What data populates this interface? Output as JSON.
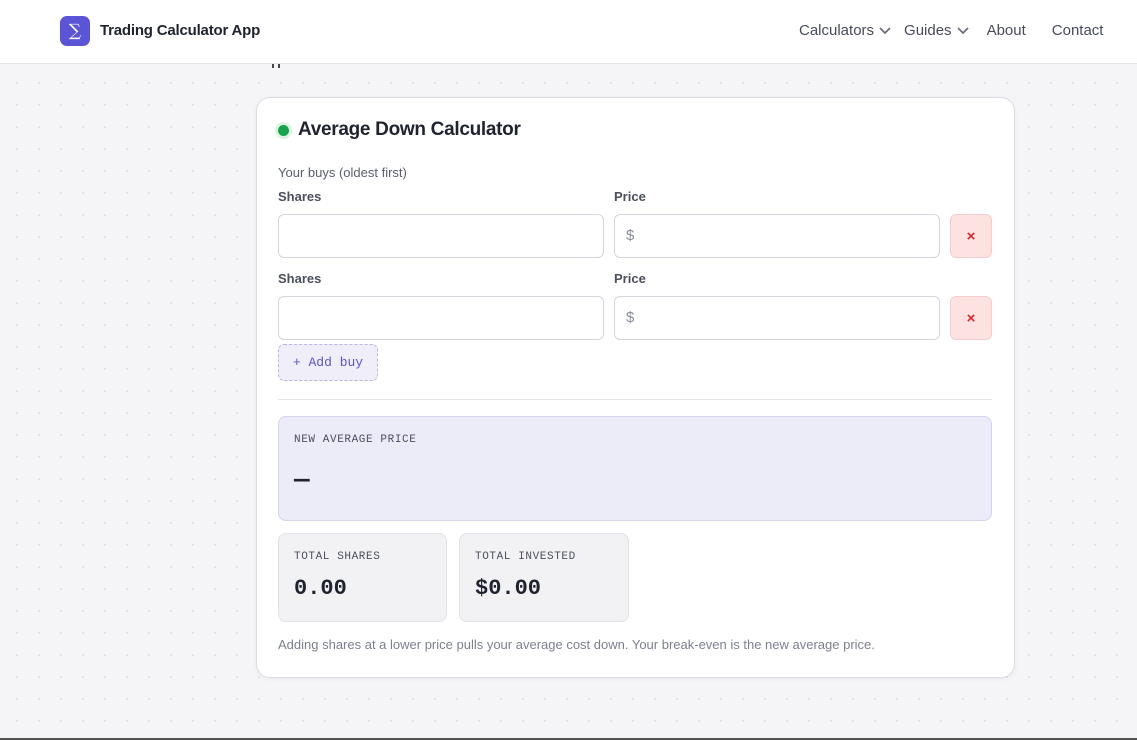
{
  "header": {
    "logo_glyph": "∑",
    "brand": "Trading Calculator App",
    "nav": [
      {
        "label": "Calculators",
        "icon": "chevron-down-icon"
      },
      {
        "label": "Guides",
        "icon": "chevron-down-icon"
      },
      {
        "label": "About"
      },
      {
        "label": "Contact"
      }
    ]
  },
  "calculator": {
    "title": "Average Down Calculator",
    "status_color": "#16a34a",
    "hint": "Your buys (oldest first)",
    "rows": [
      {
        "shares_label": "Shares",
        "price_label": "Price",
        "shares_value": "",
        "price_value": "",
        "currency": "$",
        "remove_label": "×"
      },
      {
        "shares_label": "Shares",
        "price_label": "Price",
        "shares_value": "",
        "price_value": "",
        "currency": "$",
        "remove_label": "×"
      }
    ],
    "add_label": "+ Add buy",
    "result": {
      "label": "NEW AVERAGE PRICE",
      "value": "—"
    },
    "stats": [
      {
        "label": "TOTAL SHARES",
        "value": "0.00"
      },
      {
        "label": "TOTAL INVESTED",
        "value": "$0.00"
      }
    ],
    "note": "Adding shares at a lower price pulls your average cost down. Your break-even is the new average price."
  },
  "colors": {
    "accent": "#5b54d6",
    "danger": "#dc2626"
  }
}
